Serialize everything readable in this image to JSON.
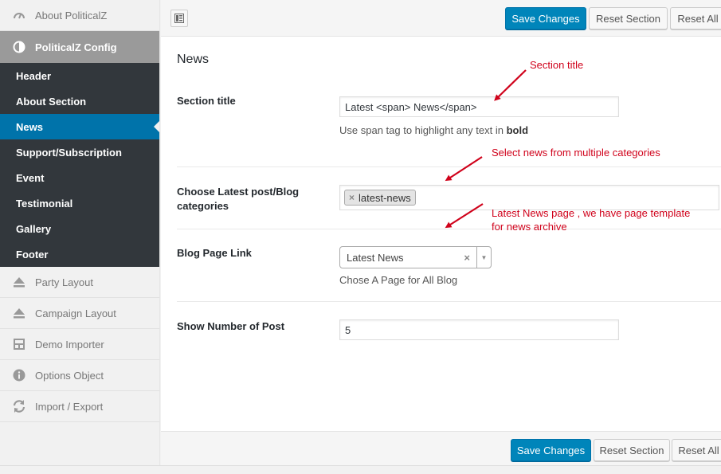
{
  "sidebar": {
    "top_item": {
      "label": "About PoliticalZ",
      "icon": "dashboard-icon"
    },
    "config_item": {
      "label": "PoliticalZ Config",
      "icon": "half-circle-icon"
    },
    "submenu": [
      {
        "label": "Header"
      },
      {
        "label": "About Section"
      },
      {
        "label": "News"
      },
      {
        "label": "Support/Subscription"
      },
      {
        "label": "Event"
      },
      {
        "label": "Testimonial"
      },
      {
        "label": "Gallery"
      },
      {
        "label": "Footer"
      }
    ],
    "bottom_items": [
      {
        "label": "Party Layout",
        "icon": "eject-icon"
      },
      {
        "label": "Campaign Layout",
        "icon": "eject-icon"
      },
      {
        "label": "Demo Importer",
        "icon": "layout-icon"
      },
      {
        "label": "Options Object",
        "icon": "info-icon"
      },
      {
        "label": "Import / Export",
        "icon": "refresh-icon"
      }
    ]
  },
  "toolbar": {
    "save_label": "Save Changes",
    "reset_section_label": "Reset Section",
    "reset_all_label": "Reset All"
  },
  "section": {
    "title": "News",
    "fields": {
      "section_title": {
        "label": "Section title",
        "value": "Latest <span> News</span>",
        "desc_prefix": "Use span tag to highlight any text in ",
        "desc_bold": "bold"
      },
      "categories": {
        "label": "Choose Latest post/Blog categories",
        "tag": "latest-news",
        "remove": "×"
      },
      "blog_link": {
        "label": "Blog Page Link",
        "value": "Latest News",
        "clear": "×",
        "desc": "Chose A Page for All Blog"
      },
      "num_posts": {
        "label": "Show Number of Post",
        "value": "5"
      }
    }
  },
  "annotations": {
    "section_title": "Section title",
    "categories": "Select news from multiple categories",
    "blog_line1": "Latest News page , we have page template",
    "blog_line2": "for news archive"
  },
  "colors": {
    "accent": "#0073aa",
    "annotation": "#d0021b",
    "submenu_bg": "#32373c"
  }
}
